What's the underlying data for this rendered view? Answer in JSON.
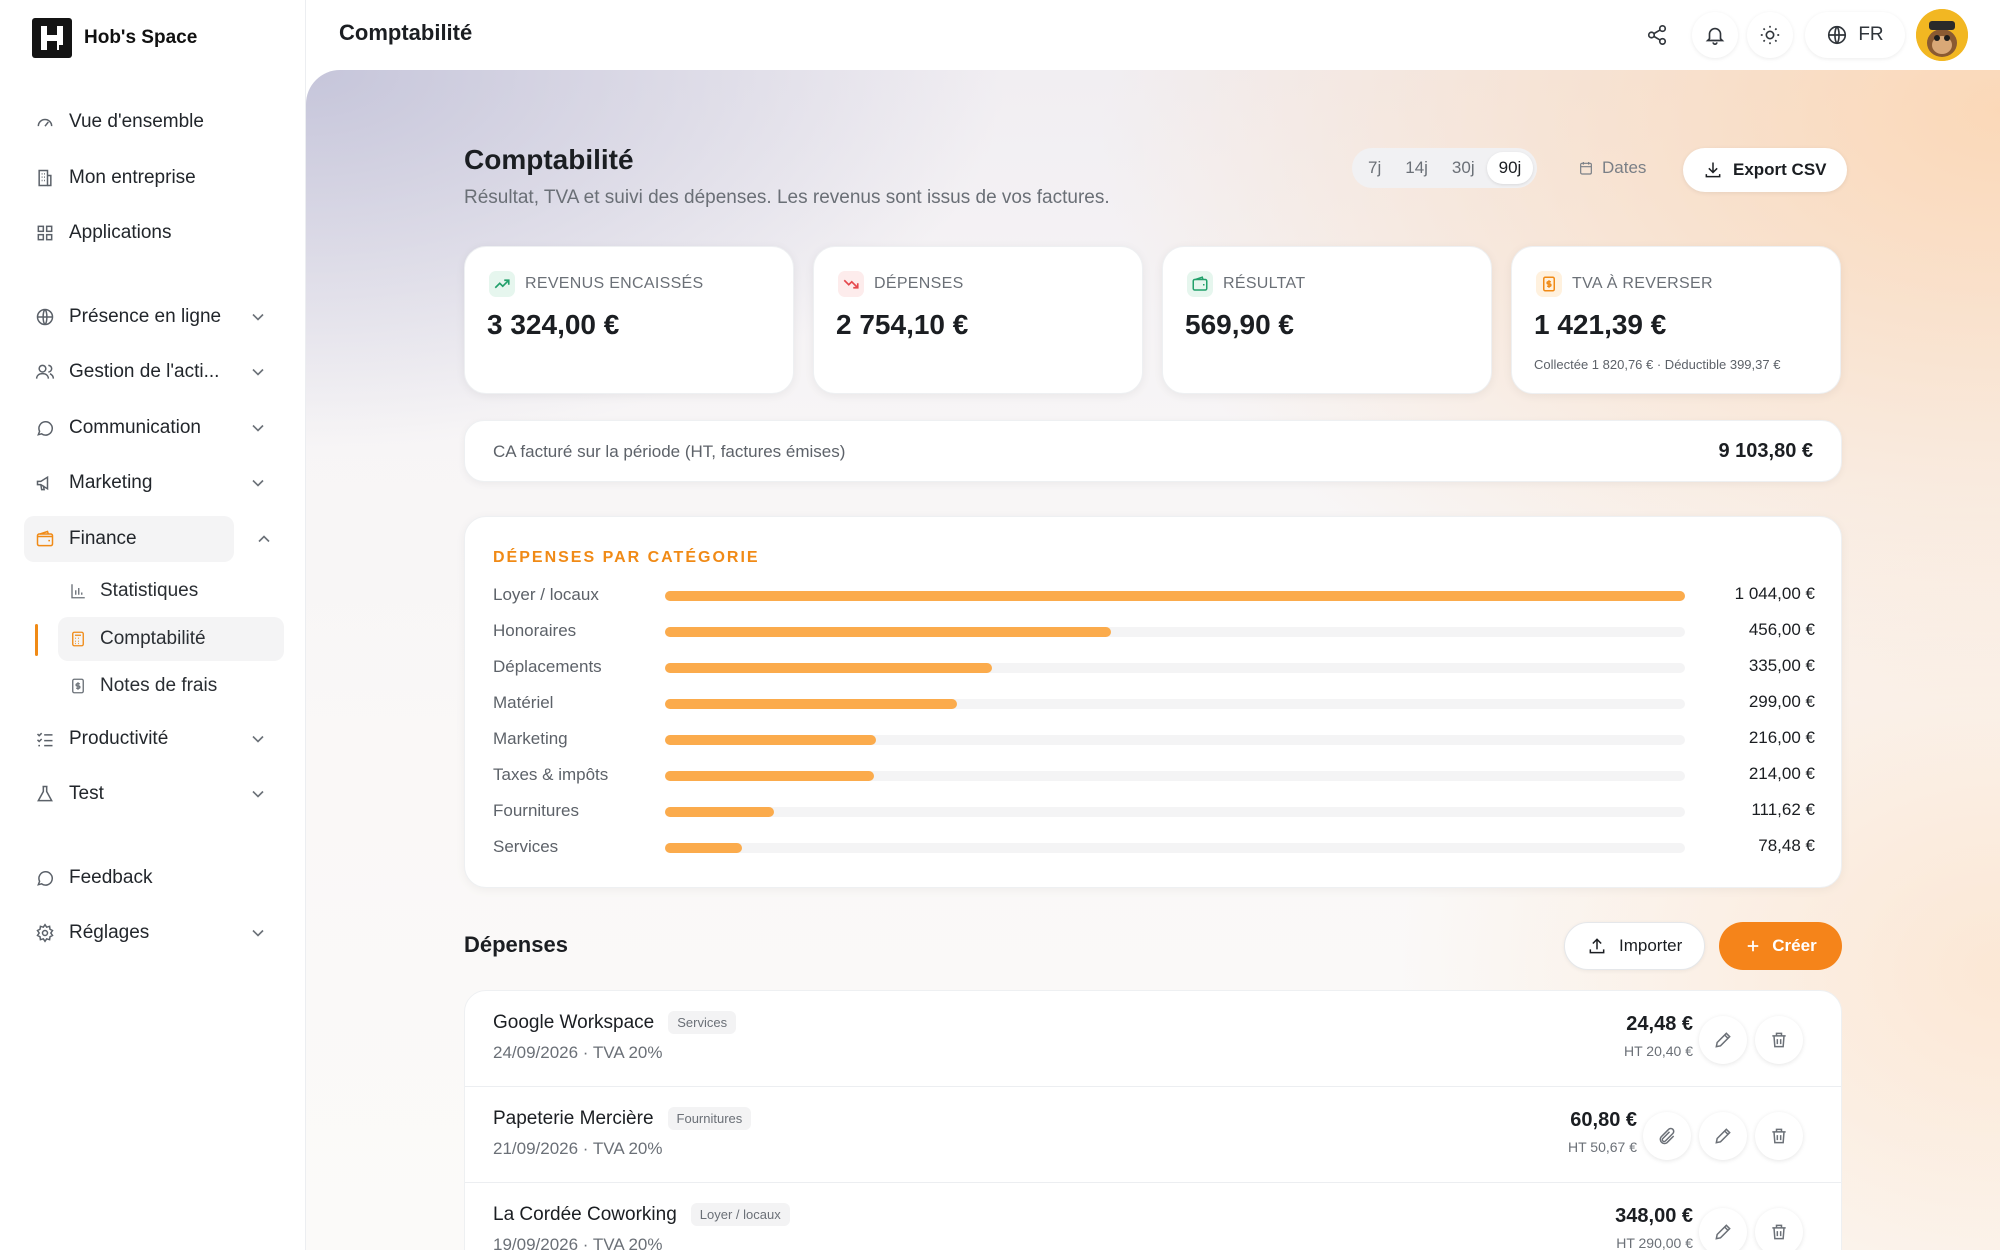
{
  "brand": {
    "name": "Hob's Space"
  },
  "nav": {
    "overview": "Vue d'ensemble",
    "company": "Mon entreprise",
    "apps": "Applications",
    "online": "Présence en ligne",
    "activity": "Gestion de l'acti...",
    "communication": "Communication",
    "marketing": "Marketing",
    "finance": "Finance",
    "finance_sub": {
      "stats": "Statistiques",
      "accounting": "Comptabilité",
      "expenses": "Notes de frais"
    },
    "productivity": "Productivité",
    "test": "Test",
    "feedback": "Feedback",
    "settings": "Réglages"
  },
  "topbar": {
    "title": "Comptabilité",
    "lang": "FR"
  },
  "page": {
    "title": "Comptabilité",
    "subtitle": "Résultat, TVA et suivi des dépenses. Les revenus sont issus de vos factures.",
    "periods": [
      "7j",
      "14j",
      "30j",
      "90j"
    ],
    "selected_period": "90j",
    "dates_label": "Dates",
    "export_label": "Export CSV"
  },
  "kpis": {
    "revenue": {
      "label": "REVENUS ENCAISSÉS",
      "value": "3 324,00 €"
    },
    "expenses": {
      "label": "DÉPENSES",
      "value": "2 754,10 €"
    },
    "result": {
      "label": "RÉSULTAT",
      "value": "569,90 €"
    },
    "vat": {
      "label": "TVA À REVERSER",
      "value": "1 421,39 €",
      "note": "Collectée 1 820,76 € · Déductible 399,37 €"
    }
  },
  "ca": {
    "label": "CA facturé sur la période (HT, factures émises)",
    "value": "9 103,80 €"
  },
  "categories": {
    "title": "DÉPENSES PAR CATÉGORIE",
    "rows": [
      {
        "name": "Loyer / locaux",
        "amount": "1 044,00 €",
        "value": 1044.0
      },
      {
        "name": "Honoraires",
        "amount": "456,00 €",
        "value": 456.0
      },
      {
        "name": "Déplacements",
        "amount": "335,00 €",
        "value": 335.0
      },
      {
        "name": "Matériel",
        "amount": "299,00 €",
        "value": 299.0
      },
      {
        "name": "Marketing",
        "amount": "216,00 €",
        "value": 216.0
      },
      {
        "name": "Taxes & impôts",
        "amount": "214,00 €",
        "value": 214.0
      },
      {
        "name": "Fournitures",
        "amount": "111,62 €",
        "value": 111.62
      },
      {
        "name": "Services",
        "amount": "78,48 €",
        "value": 78.48
      }
    ]
  },
  "expenses": {
    "title": "Dépenses",
    "import_label": "Importer",
    "create_label": "Créer",
    "items": [
      {
        "name": "Google Workspace",
        "tag": "Services",
        "meta": "24/09/2026 · TVA 20%",
        "amount": "24,48 €",
        "ht": "HT 20,40 €",
        "attachment": false
      },
      {
        "name": "Papeterie Mercière",
        "tag": "Fournitures",
        "meta": "21/09/2026 · TVA 20%",
        "amount": "60,80 €",
        "ht": "HT 50,67 €",
        "attachment": true
      },
      {
        "name": "La Cordée Coworking",
        "tag": "Loyer / locaux",
        "meta": "19/09/2026 · TVA 20%",
        "amount": "348,00 €",
        "ht": "HT 290,00 €",
        "attachment": false
      }
    ]
  },
  "colors": {
    "accent": "#f5841a",
    "bar": "#fbab4c",
    "revenue_green": "#22a06b",
    "expense_red": "#e5484d"
  }
}
